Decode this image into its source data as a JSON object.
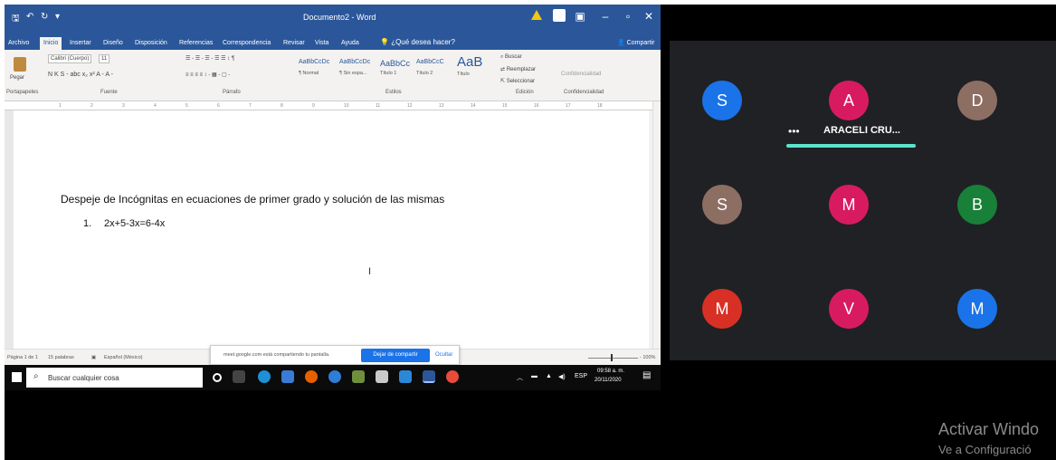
{
  "word": {
    "qat": {
      "save": "🖫",
      "undo": "↶",
      "redo": "↻",
      "more": "▾"
    },
    "title": "Documento2 - Word",
    "window_controls": {
      "ribbon_options": "▣",
      "minimize": "–",
      "restore": "▫",
      "close": "✕"
    },
    "menu": [
      "Archivo",
      "Inicio",
      "Insertar",
      "Diseño",
      "Disposición",
      "Referencias",
      "Correspondencia",
      "Revisar",
      "Vista",
      "Ayuda"
    ],
    "tell_me": "¿Qué desea hacer?",
    "share": "Compartir",
    "ribbon": {
      "paste": "Pegar",
      "font_name": "Calibri (Cuerpo)",
      "font_size": "11",
      "font_row2": "N K S - abc x₂ x² A - A -",
      "para_row1": "☰ - ☰ - ☰ - ☰ ☰ ↕ ¶",
      "para_row2": "≡ ≡ ≡ ≡ ↕ - ▦ - ▢ -",
      "styles": [
        {
          "preview": "AaBbCcDc",
          "name": "¶ Normal"
        },
        {
          "preview": "AaBbCcDc",
          "name": "¶ Sin espa..."
        },
        {
          "preview": "AaBbCc",
          "name": "Título 1"
        },
        {
          "preview": "AaBbCcC",
          "name": "Título 2"
        },
        {
          "preview": "AaB",
          "name": "Título"
        }
      ],
      "edit_find": "Buscar",
      "edit_replace": "Reemplazar",
      "edit_select": "Seleccionar",
      "confidentiality": "Confidencialidad",
      "group_labels": [
        "Portapapeles",
        "Fuente",
        "Párrafo",
        "Estilos",
        "Edición",
        "Confidencialidad"
      ]
    },
    "ruler_ticks": [
      "1",
      "2",
      "3",
      "4",
      "5",
      "6",
      "7",
      "8",
      "9",
      "10",
      "11",
      "12",
      "13",
      "14",
      "15",
      "16",
      "17",
      "18"
    ],
    "document": {
      "heading": "Despeje de Incógnitas en ecuaciones de primer grado y solución de las mismas",
      "item_number": "1.",
      "item_text": "2x+5-3x=6-4x",
      "cursor": "I"
    },
    "status": {
      "page": "Página 1 de 1",
      "words": "15 palabras",
      "language": "Español (México)",
      "zoom": "- 100%"
    }
  },
  "share_banner": {
    "text": "meet.google.com está compartiendo tu pantalla.",
    "stop_label": "Dejar de compartir",
    "hide_label": "Ocultar"
  },
  "taskbar": {
    "search_placeholder": "Buscar cualquier cosa",
    "tray_lang": "ESP",
    "time": "09:58 a. m.",
    "date": "20/11/2020"
  },
  "meet": {
    "participants": [
      {
        "initial": "S",
        "color": "#1a73e8"
      },
      {
        "initial": "A",
        "color": "#d81b60"
      },
      {
        "initial": "D",
        "color": "#8d6e63"
      },
      {
        "initial": "S",
        "color": "#8d6e63"
      },
      {
        "initial": "M",
        "color": "#d81b60"
      },
      {
        "initial": "B",
        "color": "#188038"
      },
      {
        "initial": "M",
        "color": "#d93025"
      },
      {
        "initial": "V",
        "color": "#d81b60"
      },
      {
        "initial": "M",
        "color": "#1a73e8"
      }
    ],
    "pinned_name": "ARACELI CRU...",
    "more_dots": "•••"
  },
  "watermark": {
    "title": "Activar Windo",
    "subtitle": "Ve a Configuració"
  }
}
